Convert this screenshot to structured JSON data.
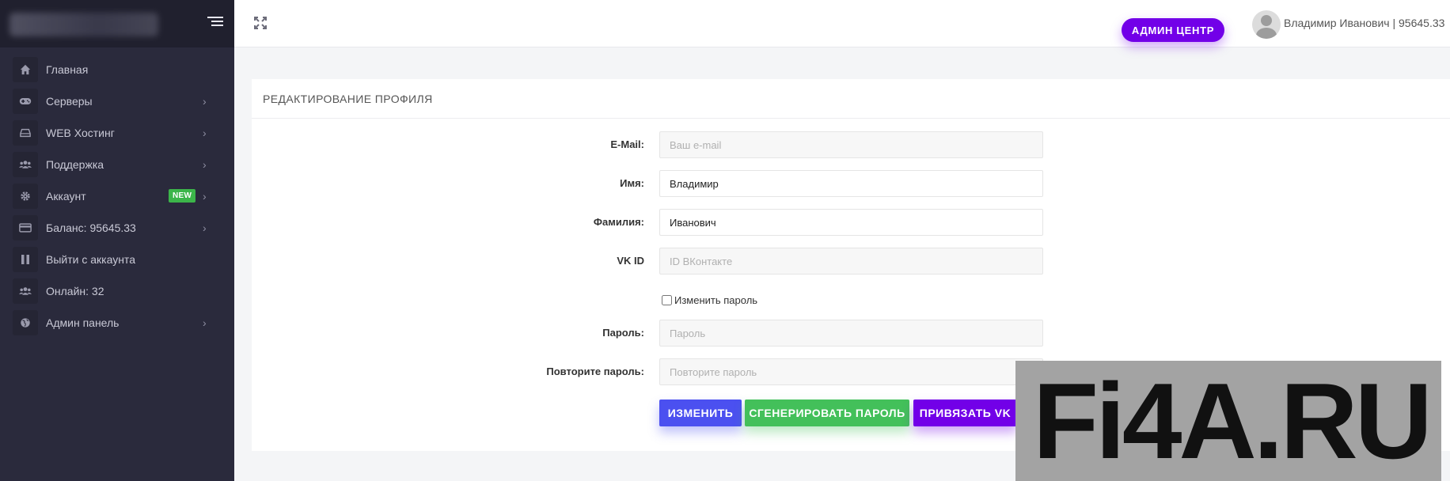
{
  "sidebar": {
    "items": [
      {
        "label": "Главная",
        "icon": "home-icon",
        "has_arrow": false
      },
      {
        "label": "Серверы",
        "icon": "gamepad-icon",
        "has_arrow": true
      },
      {
        "label": "WEB Хостинг",
        "icon": "hdd-icon",
        "has_arrow": true
      },
      {
        "label": "Поддержка",
        "icon": "users-icon",
        "has_arrow": true
      },
      {
        "label": "Аккаунт",
        "icon": "gear-icon",
        "has_arrow": true,
        "badge": "NEW"
      },
      {
        "label": "Баланс: 95645.33",
        "icon": "credit-card-icon",
        "has_arrow": true
      },
      {
        "label": "Выйти с аккаунта",
        "icon": "pause-icon",
        "has_arrow": false
      },
      {
        "label": "Онлайн: 32",
        "icon": "users-icon",
        "has_arrow": false
      },
      {
        "label": "Админ панель",
        "icon": "globe-icon",
        "has_arrow": true
      }
    ]
  },
  "topbar": {
    "admin_button": "АДМИН ЦЕНТР",
    "user_text": "Владимир Иванович | 95645.33"
  },
  "card": {
    "title": "РЕДАКТИРОВАНИЕ ПРОФИЛЯ",
    "fields": {
      "email": {
        "label": "E-Mail:",
        "value": "",
        "placeholder": "Ваш e-mail"
      },
      "first_name": {
        "label": "Имя:",
        "value": "Владимир",
        "placeholder": ""
      },
      "last_name": {
        "label": "Фамилия:",
        "value": "Иванович",
        "placeholder": ""
      },
      "vk_id": {
        "label": "VK ID",
        "value": "",
        "placeholder": "ID ВКонтакте"
      },
      "password": {
        "label": "Пароль:",
        "value": "",
        "placeholder": "Пароль"
      },
      "password_repeat": {
        "label": "Повторите пароль:",
        "value": "",
        "placeholder": "Повторите пароль"
      }
    },
    "change_password_label": "Изменить пароль",
    "buttons": {
      "change": "ИЗМЕНИТЬ",
      "generate": "СГЕНЕРИРОВАТЬ ПАРОЛЬ",
      "link_vk": "ПРИВЯЗАТЬ VK"
    }
  },
  "watermark": "Fi4A.RU",
  "colors": {
    "sidebar_bg": "#2a2a3c",
    "accent_purple": "#7200e8",
    "button_blue": "#4b50f0",
    "button_green": "#43c05a",
    "badge_green": "#3cb54a"
  }
}
